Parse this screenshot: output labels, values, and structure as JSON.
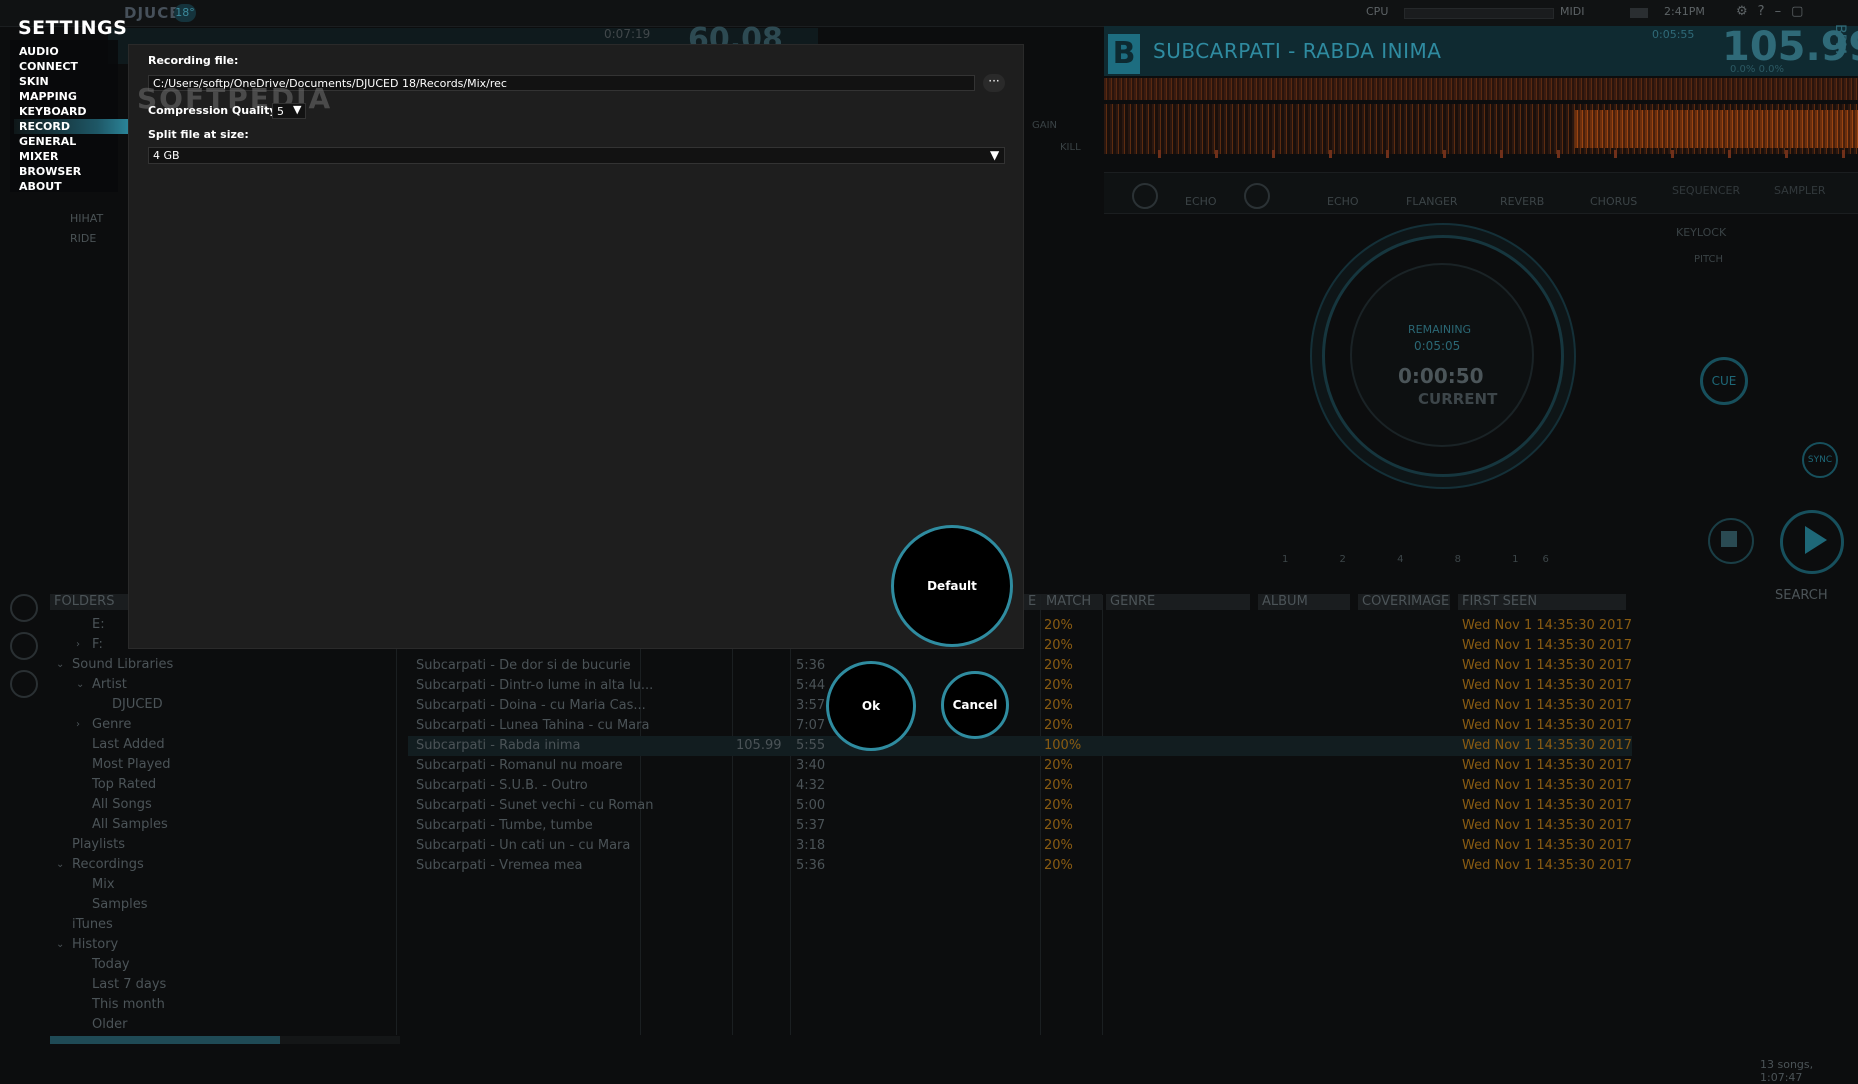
{
  "app": {
    "logo": "DJUCED",
    "logo_badge": "18°",
    "cpu_label": "CPU",
    "midi_label": "MIDI",
    "clock": "2:41PM"
  },
  "deck_a": {
    "time": "0:07:19",
    "bpm": "60.08",
    "mid_label": "B",
    "hihat": "HIHAT",
    "ride": "RIDE"
  },
  "deck_b": {
    "badge": "B",
    "title": "SUBCARPATI - RABDA INIMA",
    "time": "0:05:55",
    "bpm": "105.99",
    "bpm_label": "BPM",
    "bpm_sub": "0.0%   0.0%",
    "gain": "GAIN",
    "kill": "KILL",
    "fx_labels": [
      "ECHO",
      "ECHO",
      "FLANGER",
      "REVERB",
      "CHORUS"
    ],
    "sequencer": "SEQUENCER",
    "sampler": "SAMPLER",
    "keylock": "KEYLOCK",
    "pitch": "PITCH",
    "remaining_label": "REMAINING",
    "remaining_value": "0:05:05",
    "current_value": "0:00:50",
    "current_label": "CURRENT",
    "cue": "CUE",
    "sync": "SYNC",
    "loop_numbers": "1 2 4 8 16"
  },
  "browser": {
    "folders_header": "FOLDERS",
    "folders": [
      {
        "label": "E:",
        "indent": 1,
        "arrow": ""
      },
      {
        "label": "F:",
        "indent": 1,
        "arrow": "›"
      },
      {
        "label": "Sound Libraries",
        "indent": 0,
        "arrow": "⌄"
      },
      {
        "label": "Artist",
        "indent": 1,
        "arrow": "⌄"
      },
      {
        "label": "DJUCED",
        "indent": 2,
        "arrow": ""
      },
      {
        "label": "Genre",
        "indent": 1,
        "arrow": "›"
      },
      {
        "label": "Last Added",
        "indent": 1,
        "arrow": ""
      },
      {
        "label": "Most Played",
        "indent": 1,
        "arrow": ""
      },
      {
        "label": "Top Rated",
        "indent": 1,
        "arrow": ""
      },
      {
        "label": "All Songs",
        "indent": 1,
        "arrow": ""
      },
      {
        "label": "All Samples",
        "indent": 1,
        "arrow": ""
      },
      {
        "label": "Playlists",
        "indent": 0,
        "arrow": ""
      },
      {
        "label": "Recordings",
        "indent": 0,
        "arrow": "⌄"
      },
      {
        "label": "Mix",
        "indent": 1,
        "arrow": ""
      },
      {
        "label": "Samples",
        "indent": 1,
        "arrow": ""
      },
      {
        "label": "iTunes",
        "indent": 0,
        "arrow": ""
      },
      {
        "label": "History",
        "indent": 0,
        "arrow": "⌄"
      },
      {
        "label": "Today",
        "indent": 1,
        "arrow": ""
      },
      {
        "label": "Last 7 days",
        "indent": 1,
        "arrow": ""
      },
      {
        "label": "This month",
        "indent": 1,
        "arrow": ""
      },
      {
        "label": "Older",
        "indent": 1,
        "arrow": ""
      }
    ],
    "columns": [
      "E",
      "MATCH",
      "GENRE",
      "ALBUM",
      "COVERIMAGE",
      "FIRST SEEN"
    ],
    "search_header": "SEARCH",
    "tracks": [
      {
        "title": "",
        "bpm": "",
        "time": "",
        "match": "20%",
        "seen": "Wed Nov 1 14:35:30 2017"
      },
      {
        "title": "",
        "bpm": "",
        "time": "",
        "match": "20%",
        "seen": "Wed Nov 1 14:35:30 2017"
      },
      {
        "title": "Subcarpati - De dor si de bucurie",
        "bpm": "",
        "time": "5:36",
        "match": "20%",
        "seen": "Wed Nov 1 14:35:30 2017"
      },
      {
        "title": "Subcarpati - Dintr-o lume in alta lu...",
        "bpm": "",
        "time": "5:44",
        "match": "20%",
        "seen": "Wed Nov 1 14:35:30 2017"
      },
      {
        "title": "Subcarpati - Doina - cu Maria Cas...",
        "bpm": "",
        "time": "3:57",
        "match": "20%",
        "seen": "Wed Nov 1 14:35:30 2017"
      },
      {
        "title": "Subcarpati - Lunea Tahina - cu Mara",
        "bpm": "",
        "time": "7:07",
        "match": "20%",
        "seen": "Wed Nov 1 14:35:30 2017"
      },
      {
        "title": "Subcarpati - Rabda inima",
        "bpm": "105.99",
        "time": "5:55",
        "match": "100%",
        "seen": "Wed Nov 1 14:35:30 2017"
      },
      {
        "title": "Subcarpati - Romanul nu moare",
        "bpm": "",
        "time": "3:40",
        "match": "20%",
        "seen": "Wed Nov 1 14:35:30 2017"
      },
      {
        "title": "Subcarpati - S.U.B. - Outro",
        "bpm": "",
        "time": "4:32",
        "match": "20%",
        "seen": "Wed Nov 1 14:35:30 2017"
      },
      {
        "title": "Subcarpati - Sunet vechi - cu Roman",
        "bpm": "",
        "time": "5:00",
        "match": "20%",
        "seen": "Wed Nov 1 14:35:30 2017"
      },
      {
        "title": "Subcarpati - Tumbe, tumbe",
        "bpm": "",
        "time": "5:37",
        "match": "20%",
        "seen": "Wed Nov 1 14:35:30 2017"
      },
      {
        "title": "Subcarpati - Un cati un - cu Mara",
        "bpm": "",
        "time": "3:18",
        "match": "20%",
        "seen": "Wed Nov 1 14:35:30 2017"
      },
      {
        "title": "Subcarpati - Vremea mea",
        "bpm": "",
        "time": "5:36",
        "match": "20%",
        "seen": "Wed Nov 1 14:35:30 2017"
      }
    ],
    "status": "13 songs, 1:07:47"
  },
  "settings": {
    "title": "SETTINGS",
    "nav": [
      "AUDIO",
      "CONNECT",
      "SKIN",
      "MAPPING",
      "KEYBOARD",
      "RECORD",
      "GENERAL",
      "MIXER",
      "BROWSER",
      "ABOUT"
    ],
    "active": "RECORD",
    "watermark": "SOFTPEDIA",
    "recording_file_label": "Recording file:",
    "recording_file_value": "C:/Users/softp/OneDrive/Documents/DJUCED 18/Records/Mix/rec",
    "browse_label": "···",
    "compression_label": "Compression Quality",
    "compression_value": "5",
    "split_label": "Split file at size:",
    "split_value": "4 GB",
    "default_button": "Default",
    "ok_button": "Ok",
    "cancel_button": "Cancel",
    "accent_color": "#2f8ca0"
  }
}
